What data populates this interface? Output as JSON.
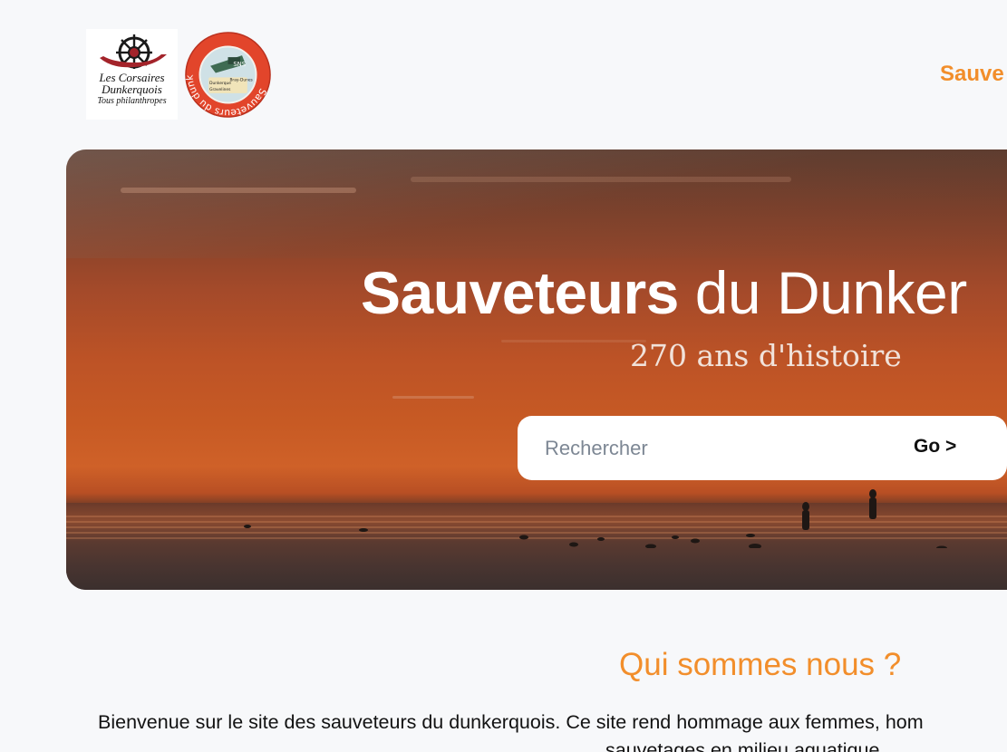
{
  "header": {
    "logo_corsaires": {
      "line1": "Les Corsaires",
      "line2": "Dunkerquois",
      "line3": "Tous philanthropes"
    },
    "logo_sauveteurs": {
      "ring_text": "Sauveteurs du dunkerquois",
      "center_text": "SNS",
      "places": [
        "Dunkerque",
        "Gravelines",
        "Bray-Dunes"
      ]
    },
    "nav_link": "Sauve"
  },
  "hero": {
    "title_bold": "Sauveteurs",
    "title_light": " du Dunker",
    "subtitle": "270 ans d'histoire",
    "search": {
      "placeholder": "Rechercher",
      "value": "",
      "button_label": "Go >"
    }
  },
  "about": {
    "title": "Qui sommes nous ?",
    "text_line1": "Bienvenue sur le site des sauveteurs du dunkerquois. Ce site rend hommage aux femmes, hom",
    "text_line2": "sauvetages en milieu aquatique"
  },
  "colors": {
    "accent": "#f28e2b",
    "background": "#f7f8fa",
    "text": "#121212",
    "search_placeholder": "#7d8794"
  },
  "icons": [
    "ship-wheel-icon",
    "lifebuoy-icon"
  ]
}
